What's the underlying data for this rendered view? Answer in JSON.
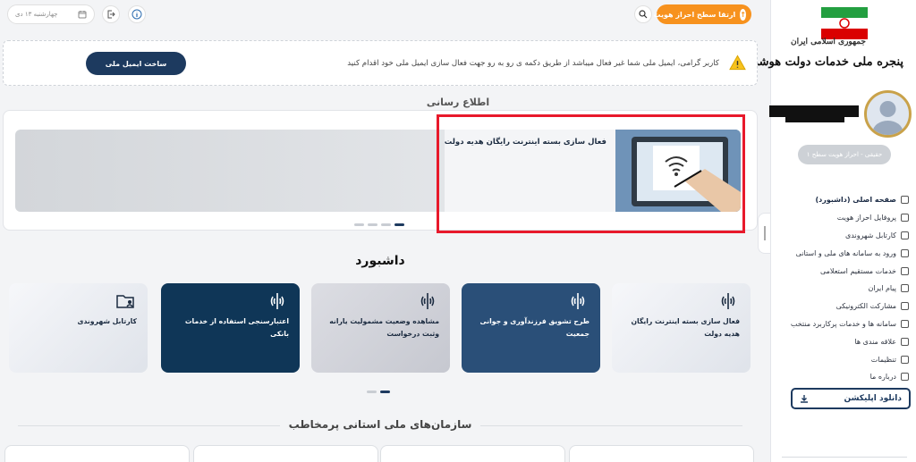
{
  "sidebar": {
    "brand_subtitle": "جمهوری اسلامی ایران",
    "brand_title": "پنجره ملی خدمات دولت هوشمند",
    "auth_badge": "حقیقی - احراز هویت سطح ۱",
    "menu": [
      {
        "label": "صفحه اصلی (داشبورد)",
        "icon": "dashboard-icon"
      },
      {
        "label": "پروفایل احراز هویت",
        "icon": "id-card-icon"
      },
      {
        "label": "کارتابل شهروندی",
        "icon": "folder-icon"
      },
      {
        "label": "ورود به سامانه های ملی و استانی",
        "icon": "login-icon"
      },
      {
        "label": "خدمات مستقیم استعلامی",
        "icon": "layers-icon"
      },
      {
        "label": "پیام ایران",
        "icon": "message-icon"
      },
      {
        "label": "مشارکت الکترونیکی",
        "icon": "chat-icon"
      },
      {
        "label": "سامانه ها و خدمات پرکاربرد منتخب",
        "icon": "users-icon"
      },
      {
        "label": "علاقه مندی ها",
        "icon": "bookmark-icon"
      },
      {
        "label": "تنظیمات",
        "icon": "gear-icon"
      },
      {
        "label": "درباره ما",
        "icon": "phone-icon"
      }
    ],
    "download_label": "دانلود اپلیکشن"
  },
  "topbar": {
    "upgrade_label": "ارتقا سطح احراز هویت",
    "date": "چهارشنبه ۱۳ دی"
  },
  "notice": {
    "text": "کاربر گرامی، ایمیل ملی شما غیر فعال میباشد از طریق دکمه ی رو به رو جهت فعال سازی ایمیل ملی خود اقدام کنید",
    "button_label": "ساخت ایمیل ملی"
  },
  "news": {
    "section_title": "اطلاع رسانی",
    "slide_title": "فعال سازی بسته اینترنت رایگان هدیه دولت"
  },
  "dashboard": {
    "title": "داشبورد",
    "cards": [
      {
        "label": "فعال سازی بسته اینترنت رایگان هدیه دولت"
      },
      {
        "label": "طرح تشویق فرزندآوری و جوانی جمعیت"
      },
      {
        "label": "مشاهده وضعیت مشمولیت یارانه وثبت درخواست"
      },
      {
        "label": "اعتبارسنجی استفاده از خدمات بانکی"
      },
      {
        "label": "کارتابل شهروندی"
      }
    ]
  },
  "orgs": {
    "title": "سازمان‌های ملی استانی پرمخاطب"
  },
  "colors": {
    "primary": "#1d3a5f",
    "accent": "#f7921e",
    "highlight_box": "#e8192b"
  }
}
